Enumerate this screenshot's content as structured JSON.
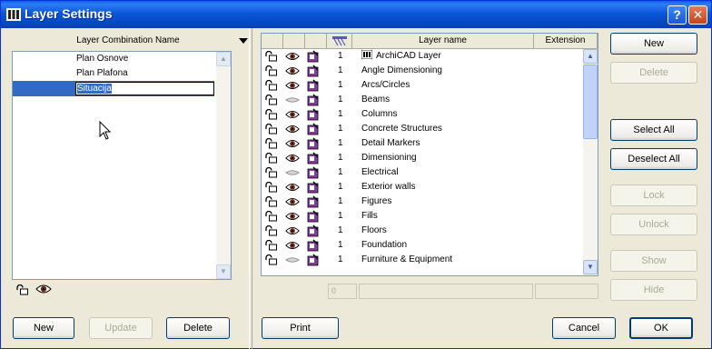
{
  "window": {
    "title": "Layer Settings",
    "help_label": "?",
    "close_label": "✕"
  },
  "combinations": {
    "header": "Layer Combination Name",
    "items": [
      "Plan Osnove",
      "Plan Plafona"
    ],
    "editing_value": "Situacija",
    "buttons": {
      "new": "New",
      "update": "Update",
      "delete": "Delete"
    }
  },
  "layers": {
    "columns": {
      "name": "Layer name",
      "extension": "Extension"
    },
    "rows": [
      {
        "num": "1",
        "name": "ArchiCAD Layer",
        "visible": true,
        "archicad": true
      },
      {
        "num": "1",
        "name": "Angle Dimensioning",
        "visible": true
      },
      {
        "num": "1",
        "name": "Arcs/Circles",
        "visible": true
      },
      {
        "num": "1",
        "name": "Beams",
        "visible": false
      },
      {
        "num": "1",
        "name": "Columns",
        "visible": true
      },
      {
        "num": "1",
        "name": "Concrete Structures",
        "visible": true
      },
      {
        "num": "1",
        "name": "Detail Markers",
        "visible": true
      },
      {
        "num": "1",
        "name": "Dimensioning",
        "visible": true
      },
      {
        "num": "1",
        "name": "Electrical",
        "visible": false
      },
      {
        "num": "1",
        "name": "Exterior walls",
        "visible": true
      },
      {
        "num": "1",
        "name": "Figures",
        "visible": true
      },
      {
        "num": "1",
        "name": "Fills",
        "visible": true
      },
      {
        "num": "1",
        "name": "Floors",
        "visible": true
      },
      {
        "num": "1",
        "name": "Foundation",
        "visible": true
      },
      {
        "num": "1",
        "name": "Furniture & Equipment",
        "visible": false
      }
    ],
    "intersection_field": "0"
  },
  "side_buttons": {
    "new": "New",
    "delete": "Delete",
    "select_all": "Select All",
    "deselect_all": "Deselect All",
    "lock": "Lock",
    "unlock": "Unlock",
    "show": "Show",
    "hide": "Hide"
  },
  "footer": {
    "print": "Print",
    "cancel": "Cancel",
    "ok": "OK"
  },
  "colors": {
    "title_bar": "#0a58d8",
    "selection": "#316ac5",
    "pen": "#8a3a9a",
    "eye": "#7a2a10"
  }
}
